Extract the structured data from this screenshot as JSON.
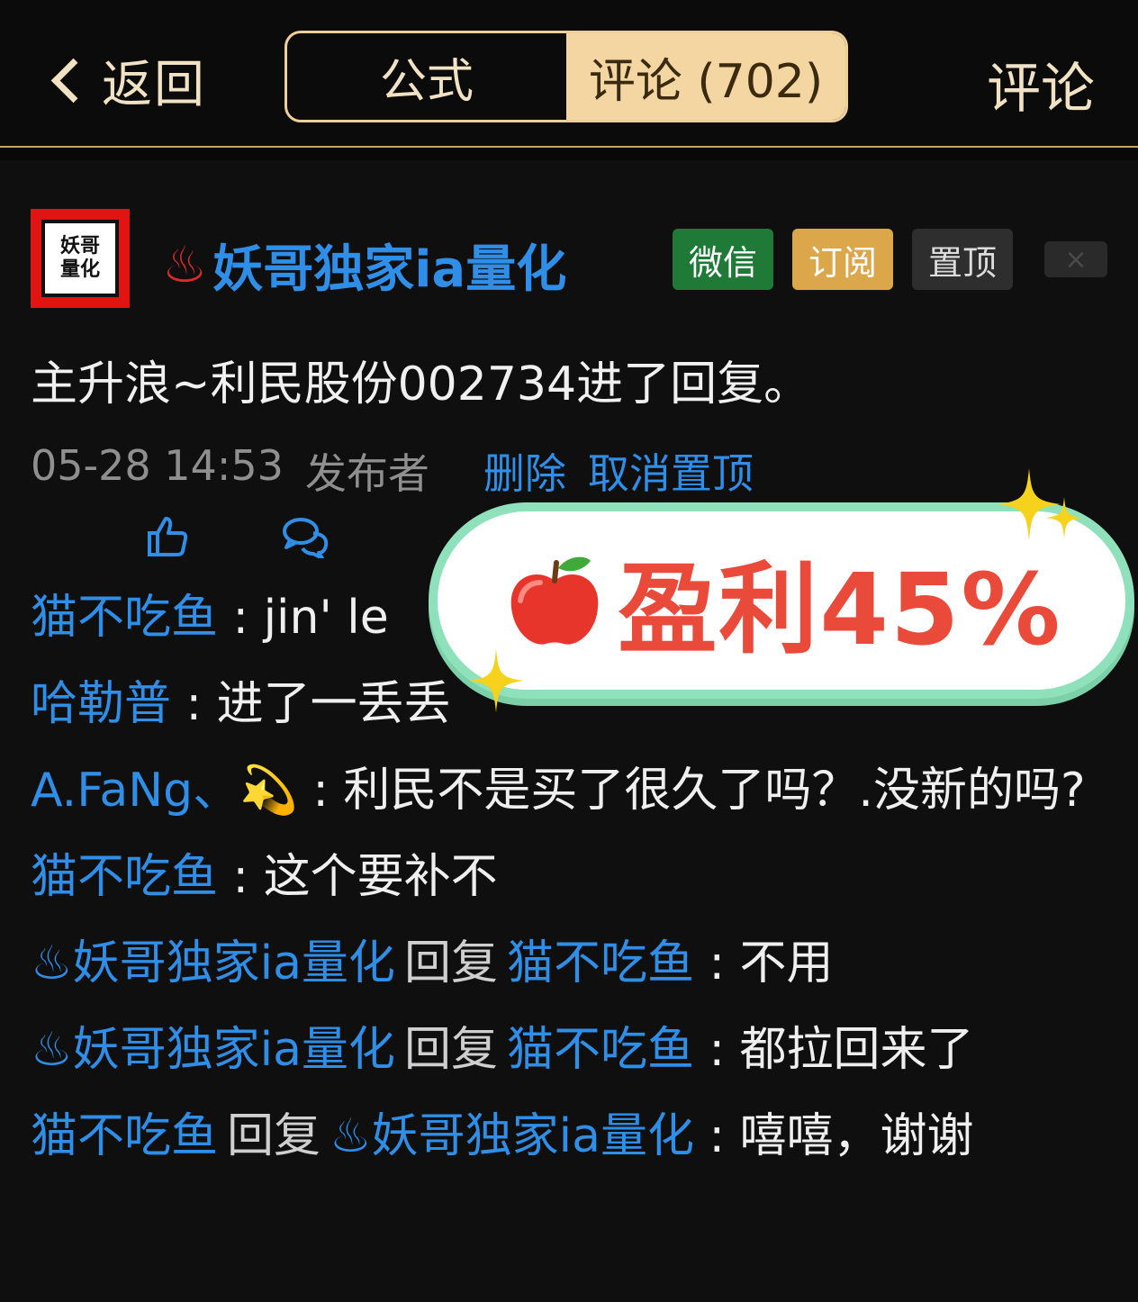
{
  "header": {
    "back_label": "返回",
    "tabs": [
      {
        "label": "公式",
        "active": false
      },
      {
        "label": "评论 (702)",
        "active": true
      }
    ],
    "right_label": "评论"
  },
  "post": {
    "avatar_text_line1": "妖哥",
    "avatar_text_line2": "量化",
    "author_icon": "♨",
    "author": "妖哥独家ia量化",
    "badges": {
      "wechat": "微信",
      "subscribe": "订阅",
      "pin": "置顶",
      "close": "×"
    },
    "text": "主升浪~利民股份002734进了回复。",
    "meta": {
      "time": "05-28 14:53",
      "role": "发布者",
      "delete": "删除",
      "unpin": "取消置顶"
    }
  },
  "comments": [
    {
      "user": "猫不吃鱼",
      "sep": " : ",
      "text": "jin' le"
    },
    {
      "user": "哈勒普",
      "sep": " : ",
      "text": "进了一丢丢"
    },
    {
      "user": "A.FaNg、💫",
      "sep": " : ",
      "text": "利民不是买了很久了吗？.没新的吗?"
    },
    {
      "user": "猫不吃鱼",
      "sep": " : ",
      "text": "这个要补不"
    },
    {
      "user": "♨妖哥独家ia量化",
      "reply": "回复",
      "target": "猫不吃鱼",
      "sep": " : ",
      "text": "不用"
    },
    {
      "user": "♨妖哥独家ia量化",
      "reply": "回复",
      "target": "猫不吃鱼",
      "sep": " : ",
      "text": "都拉回来了"
    },
    {
      "user": "猫不吃鱼",
      "reply": "回复",
      "target": "♨妖哥独家ia量化",
      "sep": " : ",
      "text": "嘻嘻，谢谢"
    }
  ],
  "overlay": {
    "emoji": "🍎",
    "text": "盈利45%"
  },
  "colors": {
    "accent_gold": "#efcf9a",
    "link_blue": "#2f8fe8",
    "profit_red": "#ea4a3a",
    "pill_border": "#8fe1bb"
  }
}
